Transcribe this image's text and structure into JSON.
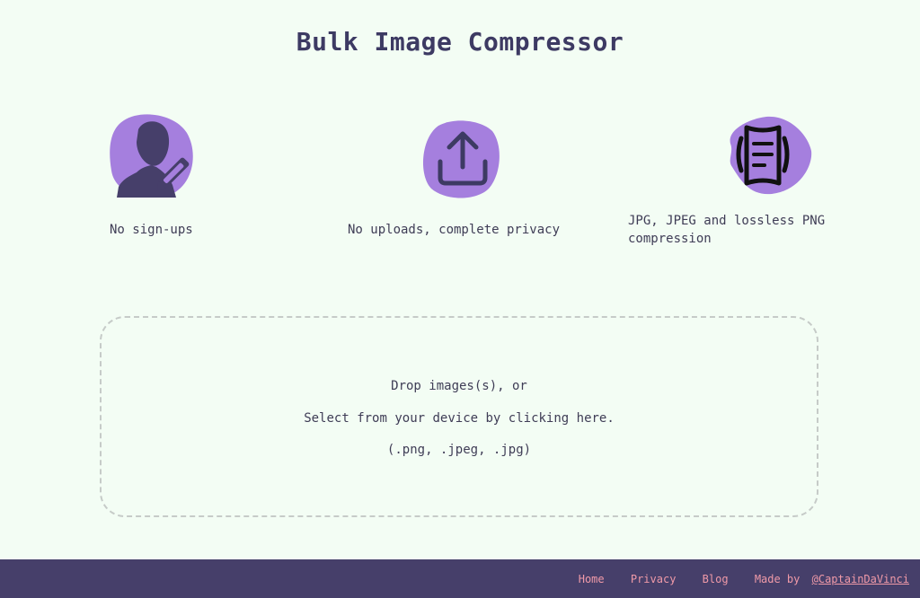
{
  "header": {
    "title": "Bulk Image Compressor"
  },
  "features": [
    {
      "icon": "user-edit-icon",
      "label": "No sign-ups"
    },
    {
      "icon": "upload-icon",
      "label": "No uploads, complete privacy"
    },
    {
      "icon": "document-compress-icon",
      "label": "JPG, JPEG and lossless PNG compression"
    }
  ],
  "dropzone": {
    "line1": "Drop images(s), or",
    "line2": "Select from your device by clicking here.",
    "line3": "(.png, .jpeg, .jpg)"
  },
  "footer": {
    "links": [
      "Home",
      "Privacy",
      "Blog"
    ],
    "made_by_label": "Made by",
    "author": "@CaptainDaVinci"
  },
  "colors": {
    "background": "#f3fdf4",
    "accent_blob": "#a57fde",
    "title": "#3d3a63",
    "footer_bg": "#463f6a",
    "footer_link": "#f09aa8"
  }
}
